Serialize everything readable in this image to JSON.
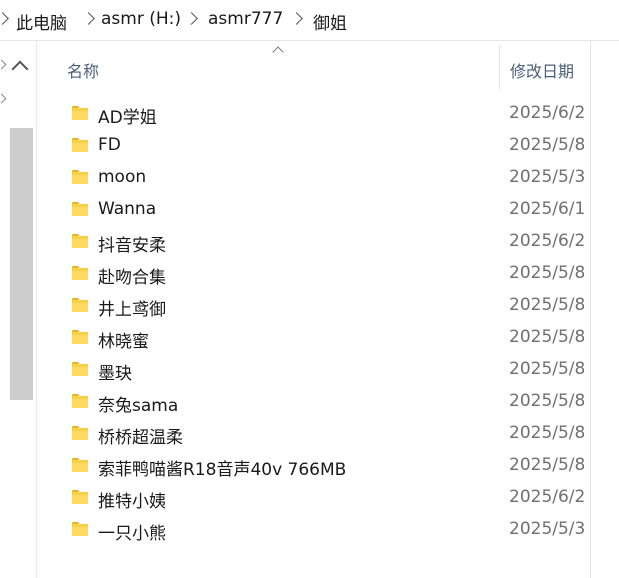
{
  "breadcrumb": {
    "items": [
      "此电脑",
      "asmr (H:)",
      "asmr777",
      "御姐"
    ]
  },
  "columns": {
    "name": "名称",
    "date_modified": "修改日期"
  },
  "files": [
    {
      "name": "AD学姐",
      "date": "2025/6/2",
      "type": "folder"
    },
    {
      "name": "FD",
      "date": "2025/5/8",
      "type": "folder"
    },
    {
      "name": "moon",
      "date": "2025/5/3",
      "type": "folder"
    },
    {
      "name": "Wanna",
      "date": "2025/6/1",
      "type": "folder"
    },
    {
      "name": "抖音安柔",
      "date": "2025/6/2",
      "type": "folder"
    },
    {
      "name": "赴吻合集",
      "date": "2025/5/8",
      "type": "folder"
    },
    {
      "name": "井上鸢御",
      "date": "2025/5/8",
      "type": "folder"
    },
    {
      "name": "林晓蜜",
      "date": "2025/5/8",
      "type": "folder"
    },
    {
      "name": "墨玦",
      "date": "2025/5/8",
      "type": "folder"
    },
    {
      "name": "奈兔sama",
      "date": "2025/5/8",
      "type": "folder"
    },
    {
      "name": "桥桥超温柔",
      "date": "2025/5/8",
      "type": "folder"
    },
    {
      "name": "索菲鸭喵酱R18音声40v 766MB",
      "date": "2025/5/8",
      "type": "folder"
    },
    {
      "name": "推特小姨",
      "date": "2025/6/2",
      "type": "folder"
    },
    {
      "name": "一只小熊",
      "date": "2025/5/3",
      "type": "folder"
    }
  ],
  "colors": {
    "folder": "#f8cf48",
    "header_text": "#4c607a",
    "date_text": "#707070",
    "scrollbar": "#cdcdcd"
  },
  "icons": {
    "folder": "folder-icon",
    "sort": "sort-up-icon",
    "separator": "chevron-right-icon"
  }
}
